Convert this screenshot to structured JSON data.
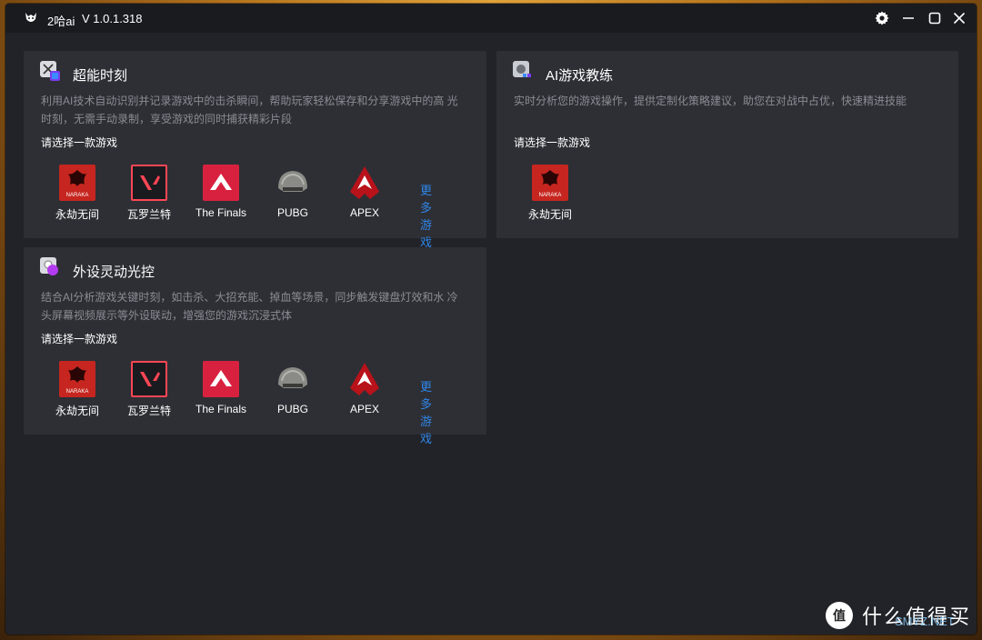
{
  "window": {
    "app_name": "2哈ai",
    "version": "V 1.0.1.318"
  },
  "cards": {
    "highlight": {
      "title": "超能时刻",
      "desc_line1": "利用AI技术自动识别并记录游戏中的击杀瞬间，帮助玩家轻松保存和分享游戏中的高 光",
      "desc_line2": "时刻，无需手动录制，享受游戏的同时捕获精彩片段",
      "prompt": "请选择一款游戏",
      "games": [
        "永劫无间",
        "瓦罗兰特",
        "The Finals",
        "PUBG",
        "APEX"
      ],
      "more": "更多游戏"
    },
    "coach": {
      "title": "AI游戏教练",
      "desc_line1": "实时分析您的游戏操作，提供定制化策略建议，助您在对战中占优，快速精进技能",
      "prompt": "请选择一款游戏",
      "games": [
        "永劫无间"
      ]
    },
    "lighting": {
      "title": "外设灵动光控",
      "desc_line1": "结合AI分析游戏关键时刻，如击杀、大招充能、掉血等场景，同步触发键盘灯效和水 冷",
      "desc_line2": "头屏幕视频展示等外设联动，增强您的游戏沉浸式体",
      "prompt": "请选择一款游戏",
      "games": [
        "永劫无间",
        "瓦罗兰特",
        "The Finals",
        "PUBG",
        "APEX"
      ],
      "more": "更多游戏"
    }
  },
  "game_logo_text": {
    "naraka": "NARAKA"
  },
  "watermark": {
    "text": "什么值得买",
    "sub": "SMYZ.NET"
  },
  "icons": {
    "app": "husky-logo-icon",
    "settings": "gear-icon",
    "minimize": "minimize-icon",
    "maximize": "maximize-icon",
    "close": "close-icon"
  },
  "colors": {
    "accent": "#2f86e8",
    "naraka": "#c6261f",
    "valorant": "#ff4655",
    "finals": "#d8213f",
    "apex": "#b8121a"
  }
}
